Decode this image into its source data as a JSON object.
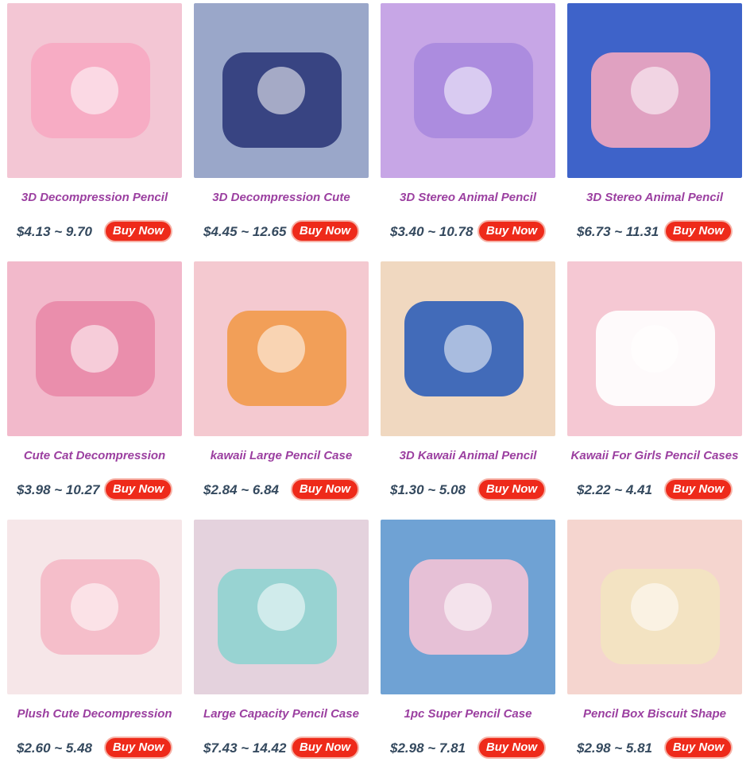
{
  "buy_label": "Buy Now",
  "products": [
    {
      "title": "3D Decompression Pencil",
      "price": "$4.13 ~ 9.70",
      "image": "pink-rabbit-pencil-case-photo",
      "bg": "#f3c6d4",
      "accent": "#f7a9c2"
    },
    {
      "title": "3D Decompression Cute",
      "price": "$4.45 ~ 12.65",
      "image": "navy-astronaut-pencil-case-photo",
      "bg": "#9aa7c9",
      "accent": "#2d3a7a"
    },
    {
      "title": "3D Stereo Animal Pencil",
      "price": "$3.40 ~ 10.78",
      "image": "purple-rabbit-pencil-case-photo",
      "bg": "#c7a6e6",
      "accent": "#a98ade"
    },
    {
      "title": "3D Stereo Animal Pencil",
      "price": "$6.73 ~ 11.31",
      "image": "blue-space-pencil-case-photo",
      "bg": "#3e63c9",
      "accent": "#f2a7c0"
    },
    {
      "title": "Cute Cat Decompression",
      "price": "$3.98 ~ 10.27",
      "image": "pink-cat-pencil-case-photo",
      "bg": "#f2b9cb",
      "accent": "#e98aa9"
    },
    {
      "title": "kawaii Large Pencil Case",
      "price": "$2.84 ~ 6.84",
      "image": "white-orange-pencil-bags-photo",
      "bg": "#f4c9d0",
      "accent": "#f29a4a"
    },
    {
      "title": "3D Kawaii Animal Pencil",
      "price": "$1.30 ~ 5.08",
      "image": "assorted-animal-pencil-cases-photo",
      "bg": "#f0d8c0",
      "accent": "#2f5fb8"
    },
    {
      "title": "Kawaii For Girls Pencil Cases",
      "price": "$2.22 ~ 4.41",
      "image": "clear-pink-pencil-case-photo",
      "bg": "#f5c8d3",
      "accent": "#ffffff"
    },
    {
      "title": "Plush Cute Decompression",
      "price": "$2.60 ~ 5.48",
      "image": "plush-pig-pencil-case-photo",
      "bg": "#f6e6e8",
      "accent": "#f5b9c6"
    },
    {
      "title": "Large Capacity Pencil Case",
      "price": "$7.43 ~ 14.42",
      "image": "teal-pink-pencil-case-photo",
      "bg": "#e4d2dd",
      "accent": "#8fd3d0"
    },
    {
      "title": "1pc Super Pencil Case",
      "price": "$2.98 ~ 7.81",
      "image": "pink-blue-pencil-bag-photo",
      "bg": "#6fa2d4",
      "accent": "#f3c3d6"
    },
    {
      "title": "Pencil Box Biscuit Shape",
      "price": "$2.98 ~ 5.81",
      "image": "biscuit-shape-pencil-box-photo",
      "bg": "#f5d5cf",
      "accent": "#f3e4c0"
    }
  ]
}
